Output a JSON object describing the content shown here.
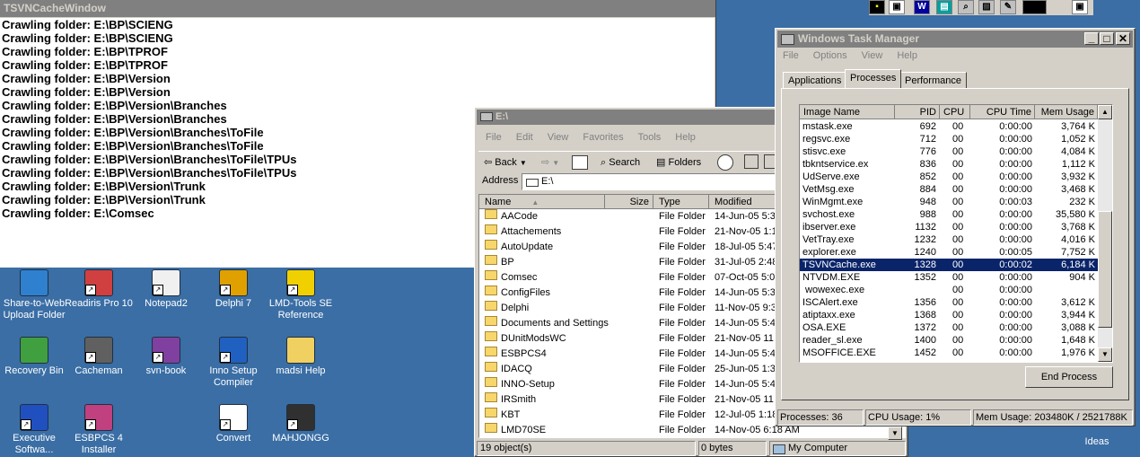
{
  "tsvn": {
    "title": "TSVNCacheWindow",
    "lines": [
      "Crawling folder: E:\\BP\\SCIENG",
      "Crawling folder: E:\\BP\\SCIENG",
      "Crawling folder: E:\\BP\\TPROF",
      "Crawling folder: E:\\BP\\TPROF",
      "Crawling folder: E:\\BP\\Version",
      "Crawling folder: E:\\BP\\Version",
      "Crawling folder: E:\\BP\\Version\\Branches",
      "Crawling folder: E:\\BP\\Version\\Branches",
      "Crawling folder: E:\\BP\\Version\\Branches\\ToFile",
      "Crawling folder: E:\\BP\\Version\\Branches\\ToFile",
      "Crawling folder: E:\\BP\\Version\\Branches\\ToFile\\TPUs",
      "Crawling folder: E:\\BP\\Version\\Branches\\ToFile\\TPUs",
      "Crawling folder: E:\\BP\\Version\\Trunk",
      "Crawling folder: E:\\BP\\Version\\Trunk",
      "Crawling folder: E:\\Comsec"
    ]
  },
  "desktop": {
    "icons": [
      {
        "label": "Share-to-Web Upload Folder",
        "icon": "hp-upload-icon"
      },
      {
        "label": "Readiris Pro 10",
        "icon": "readiris-icon"
      },
      {
        "label": "Notepad2",
        "icon": "notepad-icon"
      },
      {
        "label": "Delphi 7",
        "icon": "delphi-icon"
      },
      {
        "label": "LMD-Tools SE Reference",
        "icon": "help-icon"
      },
      {
        "label": "Recovery Bin",
        "icon": "recycle-bin-icon"
      },
      {
        "label": "Cacheman",
        "icon": "cacheman-icon"
      },
      {
        "label": "svn-book",
        "icon": "book-icon"
      },
      {
        "label": "Inno Setup Compiler",
        "icon": "inno-setup-icon"
      },
      {
        "label": "madsi Help",
        "icon": "folder-icon"
      },
      {
        "label": "Executive Softwa...",
        "icon": "executive-software-icon"
      },
      {
        "label": "ESBPCS 4 Installer",
        "icon": "installer-icon"
      },
      {
        "label": "Convert",
        "icon": "convert-icon"
      },
      {
        "label": "MAHJONGG",
        "icon": "mahjongg-icon"
      }
    ],
    "right_icon_label": "Ideas"
  },
  "explorer": {
    "title": "E:\\",
    "menu": [
      "File",
      "Edit",
      "View",
      "Favorites",
      "Tools",
      "Help"
    ],
    "toolbar": {
      "back": "Back",
      "search": "Search",
      "folders": "Folders"
    },
    "address_label": "Address",
    "address_value": "E:\\",
    "columns": [
      "Name",
      "Size",
      "Type",
      "Modified"
    ],
    "files": [
      {
        "name": "AACode",
        "type": "File Folder",
        "modified": "14-Jun-05 5:3"
      },
      {
        "name": "Attachements",
        "type": "File Folder",
        "modified": "21-Nov-05 1:1"
      },
      {
        "name": "AutoUpdate",
        "type": "File Folder",
        "modified": "18-Jul-05 5:47"
      },
      {
        "name": "BP",
        "type": "File Folder",
        "modified": "31-Jul-05 2:48"
      },
      {
        "name": "Comsec",
        "type": "File Folder",
        "modified": "07-Oct-05 5:0"
      },
      {
        "name": "ConfigFiles",
        "type": "File Folder",
        "modified": "14-Jun-05 5:3"
      },
      {
        "name": "Delphi",
        "type": "File Folder",
        "modified": "11-Nov-05 9:3"
      },
      {
        "name": "Documents and Settings",
        "type": "File Folder",
        "modified": "14-Jun-05 5:4"
      },
      {
        "name": "DUnitModsWC",
        "type": "File Folder",
        "modified": "21-Nov-05 11"
      },
      {
        "name": "ESBPCS4",
        "type": "File Folder",
        "modified": "14-Jun-05 5:4"
      },
      {
        "name": "IDACQ",
        "type": "File Folder",
        "modified": "25-Jun-05 1:3"
      },
      {
        "name": "INNO-Setup",
        "type": "File Folder",
        "modified": "14-Jun-05 5:4"
      },
      {
        "name": "IRSmith",
        "type": "File Folder",
        "modified": "21-Nov-05 11"
      },
      {
        "name": "KBT",
        "type": "File Folder",
        "modified": "12-Jul-05 1:18"
      },
      {
        "name": "LMD70SE",
        "type": "File Folder",
        "modified": "14-Nov-05 6:18 AM"
      }
    ],
    "status_objects": "19 object(s)",
    "status_size": "0 bytes",
    "status_location": "My Computer"
  },
  "taskman": {
    "title": "Windows Task Manager",
    "menu": [
      "File",
      "Options",
      "View",
      "Help"
    ],
    "tabs": [
      "Applications",
      "Processes",
      "Performance"
    ],
    "active_tab": "Processes",
    "columns": [
      "Image Name",
      "PID",
      "CPU",
      "CPU Time",
      "Mem Usage"
    ],
    "processes": [
      {
        "name": "mstask.exe",
        "pid": "692",
        "cpu": "00",
        "time": "0:00:00",
        "mem": "3,764 K"
      },
      {
        "name": "regsvc.exe",
        "pid": "712",
        "cpu": "00",
        "time": "0:00:00",
        "mem": "1,052 K"
      },
      {
        "name": "stisvc.exe",
        "pid": "776",
        "cpu": "00",
        "time": "0:00:00",
        "mem": "4,084 K"
      },
      {
        "name": "tbkntservice.ex",
        "pid": "836",
        "cpu": "00",
        "time": "0:00:00",
        "mem": "1,112 K"
      },
      {
        "name": "UdServe.exe",
        "pid": "852",
        "cpu": "00",
        "time": "0:00:00",
        "mem": "3,932 K"
      },
      {
        "name": "VetMsg.exe",
        "pid": "884",
        "cpu": "00",
        "time": "0:00:00",
        "mem": "3,468 K"
      },
      {
        "name": "WinMgmt.exe",
        "pid": "948",
        "cpu": "00",
        "time": "0:00:03",
        "mem": "232 K"
      },
      {
        "name": "svchost.exe",
        "pid": "988",
        "cpu": "00",
        "time": "0:00:00",
        "mem": "35,580 K"
      },
      {
        "name": "ibserver.exe",
        "pid": "1132",
        "cpu": "00",
        "time": "0:00:00",
        "mem": "3,768 K"
      },
      {
        "name": "VetTray.exe",
        "pid": "1232",
        "cpu": "00",
        "time": "0:00:00",
        "mem": "4,016 K"
      },
      {
        "name": "explorer.exe",
        "pid": "1240",
        "cpu": "00",
        "time": "0:00:05",
        "mem": "7,752 K"
      },
      {
        "name": "TSVNCache.exe",
        "pid": "1328",
        "cpu": "00",
        "time": "0:00:02",
        "mem": "6,184 K"
      },
      {
        "name": "NTVDM.EXE",
        "pid": "1352",
        "cpu": "00",
        "time": "0:00:00",
        "mem": "904 K"
      },
      {
        "name": " wowexec.exe",
        "pid": "",
        "cpu": "00",
        "time": "0:00:00",
        "mem": ""
      },
      {
        "name": "ISCAlert.exe",
        "pid": "1356",
        "cpu": "00",
        "time": "0:00:00",
        "mem": "3,612 K"
      },
      {
        "name": "atiptaxx.exe",
        "pid": "1368",
        "cpu": "00",
        "time": "0:00:00",
        "mem": "3,944 K"
      },
      {
        "name": "OSA.EXE",
        "pid": "1372",
        "cpu": "00",
        "time": "0:00:00",
        "mem": "3,088 K"
      },
      {
        "name": "reader_sl.exe",
        "pid": "1400",
        "cpu": "00",
        "time": "0:00:00",
        "mem": "1,648 K"
      },
      {
        "name": "MSOFFICE.EXE",
        "pid": "1452",
        "cpu": "00",
        "time": "0:00:00",
        "mem": "1,976 K"
      }
    ],
    "selected_process": "TSVNCache.exe",
    "end_process_label": "End Process",
    "status_processes": "Processes: 36",
    "status_cpu": "CPU Usage: 1%",
    "status_mem": "Mem Usage: 203480K / 2521788K"
  },
  "tray": {
    "icons": [
      "w-icon",
      "x-icon",
      "word-icon",
      "image-icon",
      "search-icon",
      "camera-icon",
      "edit-icon",
      "black-icon",
      "window-icon"
    ]
  }
}
